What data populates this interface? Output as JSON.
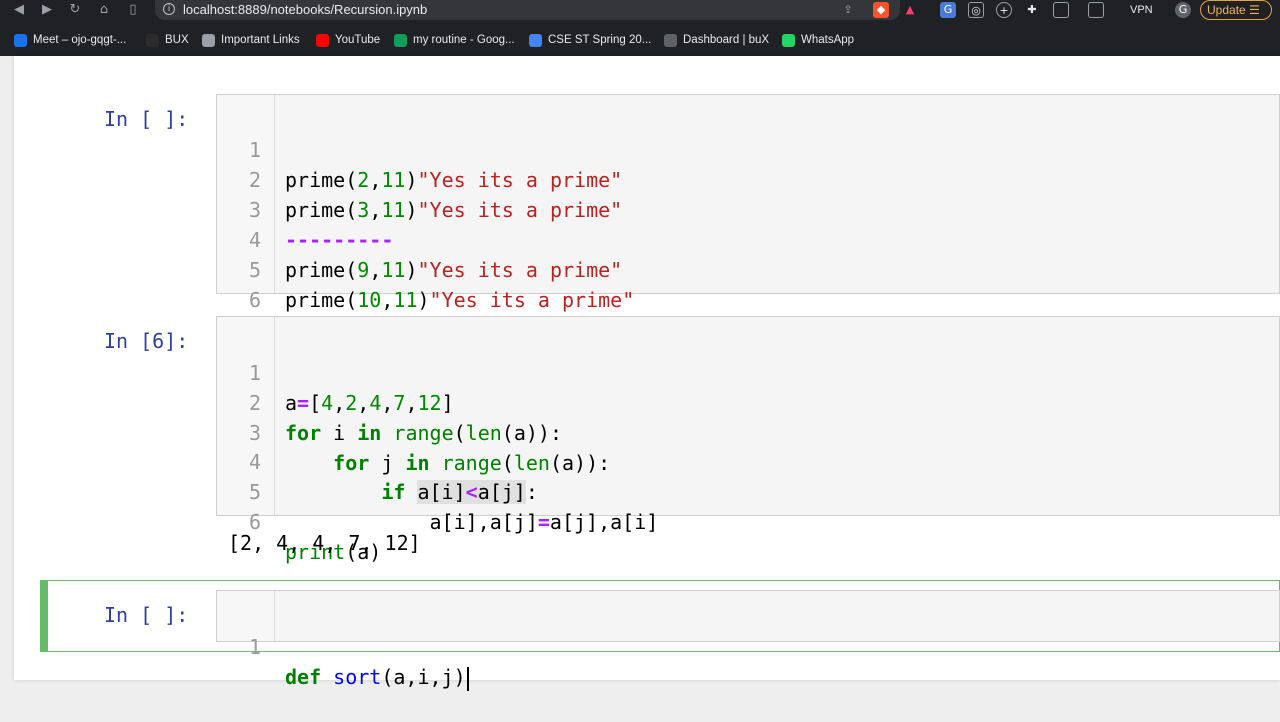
{
  "browser": {
    "url": "localhost:8889/notebooks/Recursion.ipynb",
    "vpn_label": "VPN",
    "update_label": "Update",
    "bookmarks": [
      {
        "label": "Meet – ojo-gqgt-...",
        "color": "#1a73e8"
      },
      {
        "label": "BUX",
        "color": "#2b2b2b"
      },
      {
        "label": "Important Links",
        "color": "#9aa0a6"
      },
      {
        "label": "YouTube",
        "color": "#ff0000"
      },
      {
        "label": "my routine - Goog...",
        "color": "#0f9d58"
      },
      {
        "label": "CSE ST Spring 20...",
        "color": "#4285f4"
      },
      {
        "label": "Dashboard | buX",
        "color": "#5f6368"
      },
      {
        "label": "WhatsApp",
        "color": "#25d366"
      }
    ]
  },
  "notebook": {
    "cell1": {
      "prompt": "In [ ]:",
      "line_numbers": [
        "1",
        "2",
        "3",
        "4",
        "5",
        "6"
      ],
      "lines": [
        {
          "fn": "prime",
          "args": [
            "2",
            "11"
          ],
          "str": "\"Yes its a prime\""
        },
        {
          "fn": "prime",
          "args": [
            "3",
            "11"
          ],
          "str": "\"Yes its a prime\""
        },
        {
          "sep": "---------"
        },
        {
          "fn": "prime",
          "args": [
            "9",
            "11"
          ],
          "str": "\"Yes its a prime\""
        },
        {
          "fn": "prime",
          "args": [
            "10",
            "11"
          ],
          "str": "\"Yes its a prime\""
        },
        {}
      ]
    },
    "cell2": {
      "prompt": "In [6]:",
      "line_numbers": [
        "1",
        "2",
        "3",
        "4",
        "5",
        "6"
      ],
      "tokens": {
        "a": "a",
        "eq": "=",
        "list_open": "[",
        "list_close": "]",
        "comma": ",",
        "n4": "4",
        "n2": "2",
        "n4b": "4",
        "n7": "7",
        "n12": "12",
        "for": "for",
        "i": "i",
        "j": "j",
        "in": "in",
        "range": "range",
        "len": "len",
        "if": "if",
        "lt": "<",
        "print": "print",
        "l2_tail": "(a)):",
        "l3_tail": "(a)):",
        "l4_cond_a": "a[i]",
        "l4_cond_b": "a[j]",
        "l4_colon": ":",
        "l5_lhs": "a[i],a[j]",
        "l5_rhs": "a[j],a[i]",
        "l6_tail": "(a)",
        "paren_open": "("
      },
      "output": "[2, 4, 4, 7, 12]"
    },
    "cell3": {
      "prompt": "In [ ]:",
      "line_numbers": [
        "1"
      ],
      "def_kw": "def",
      "fn_name": "sort",
      "params": "(a,i,j)"
    }
  }
}
